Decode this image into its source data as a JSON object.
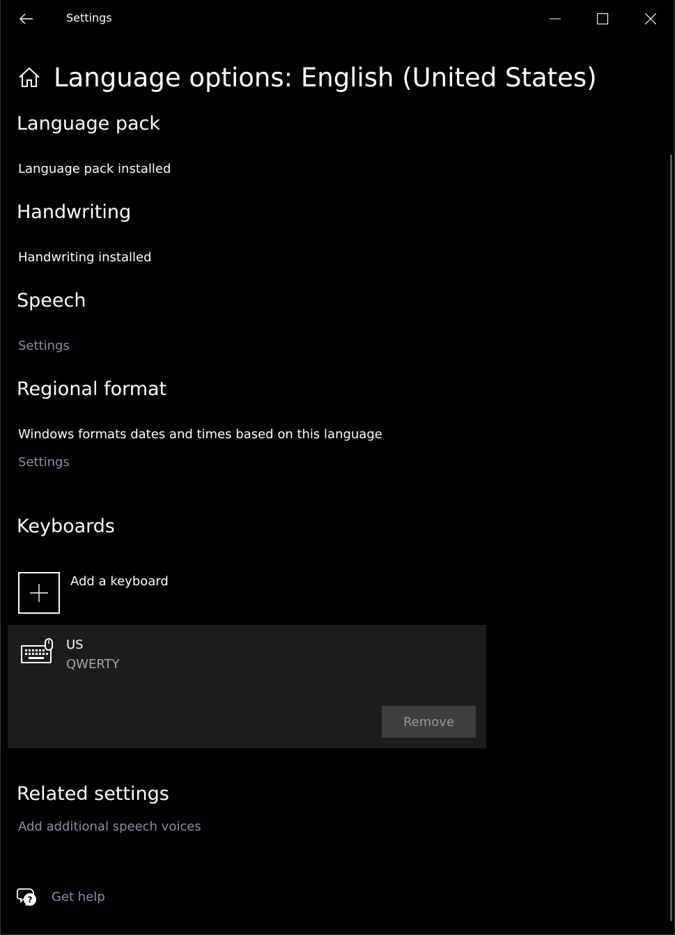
{
  "titlebar": {
    "title": "Settings",
    "back_icon": "back-arrow-icon",
    "minimize_icon": "minimize-icon",
    "maximize_icon": "maximize-icon",
    "close_icon": "close-icon"
  },
  "header": {
    "icon": "home-icon",
    "title": "Language options: English (United States)"
  },
  "language_pack": {
    "heading": "Language pack",
    "status": "Language pack installed"
  },
  "handwriting": {
    "heading": "Handwriting",
    "status": "Handwriting installed"
  },
  "speech": {
    "heading": "Speech",
    "settings_link": "Settings"
  },
  "regional_format": {
    "heading": "Regional format",
    "description": "Windows formats dates and times based on this language",
    "settings_link": "Settings"
  },
  "keyboards": {
    "heading": "Keyboards",
    "add_label": "Add a keyboard",
    "items": [
      {
        "name": "US",
        "layout": "QWERTY",
        "icon": "keyboard-icon",
        "remove_label": "Remove"
      }
    ]
  },
  "related_settings": {
    "heading": "Related settings",
    "link": "Add additional speech voices"
  },
  "help": {
    "icon": "help-chat-icon",
    "label": "Get help"
  },
  "colors": {
    "background": "#000000",
    "text": "#ffffff",
    "link": "#8a8fa6",
    "card": "#1c1c1c",
    "button": "#3e3e3e"
  }
}
